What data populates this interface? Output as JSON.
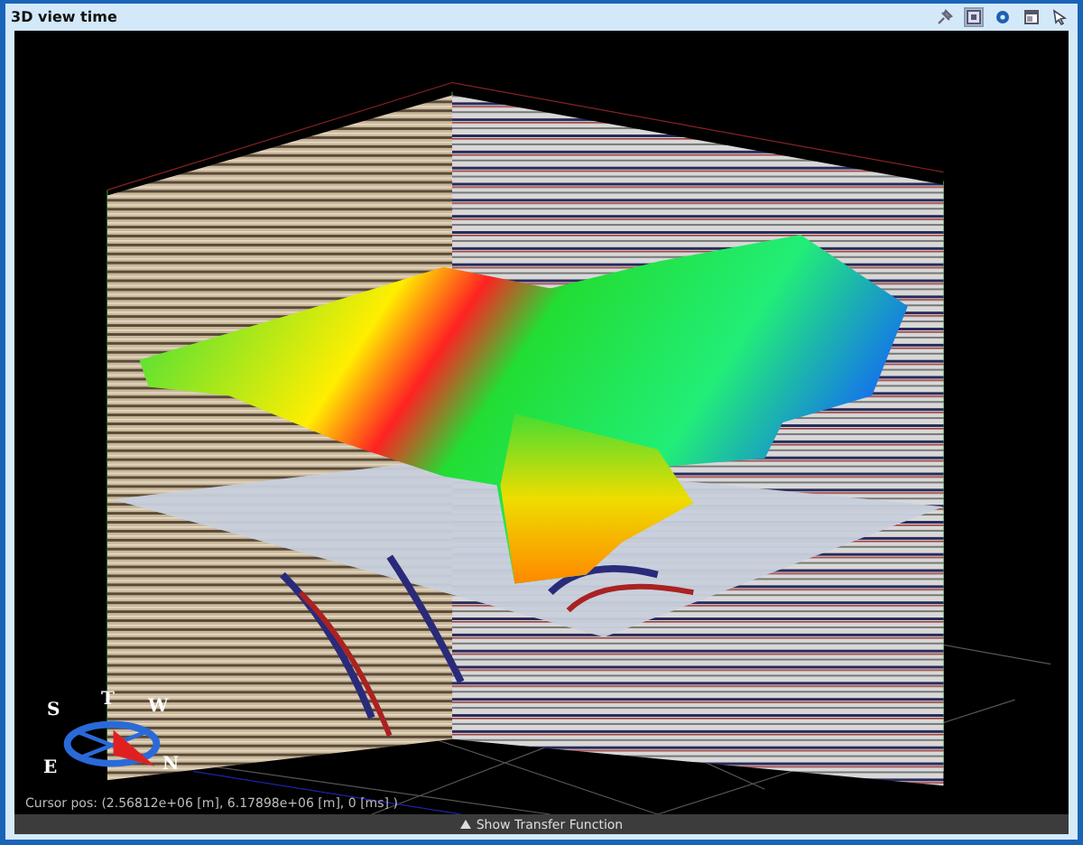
{
  "window": {
    "title": "3D view time"
  },
  "toolbar": {
    "tools": [
      {
        "kind": "pin",
        "selected": false
      },
      {
        "kind": "view",
        "selected": true
      },
      {
        "kind": "settings",
        "selected": false
      },
      {
        "kind": "window",
        "selected": false
      },
      {
        "kind": "pointer",
        "selected": false
      }
    ]
  },
  "viewport": {
    "compass": {
      "labels": [
        "S",
        "T",
        "W",
        "E",
        "N"
      ]
    },
    "cursor_pos": "Cursor pos: (2.56812e+06 [m], 6.17898e+06 [m], 0 [ms] )"
  },
  "bottom_bar": {
    "label": "Show Transfer Function"
  }
}
